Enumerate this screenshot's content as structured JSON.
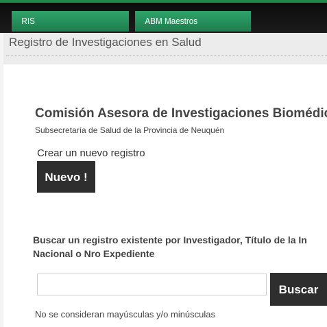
{
  "nav": {
    "tabs": [
      {
        "label": "RIS"
      },
      {
        "label": "ABM Maestros"
      }
    ]
  },
  "header": {
    "title": "Registro de Investigaciones en Salud"
  },
  "org": {
    "title": "Comisión Asesora de Investigaciones Biomédica",
    "subtitle": "Subsecretaría de Salud de la Provincia de Neuquén"
  },
  "create": {
    "label": "Crear un nuevo registro",
    "button_label": "Nuevo !"
  },
  "search": {
    "label_line1": "Buscar un registro existente por Investigador, Título de la In",
    "label_line2": "Nacional o Nro Expediente",
    "value": "",
    "button_label": "Buscar",
    "note": "No se consideran mayúsculas y/o minúsculas"
  }
}
